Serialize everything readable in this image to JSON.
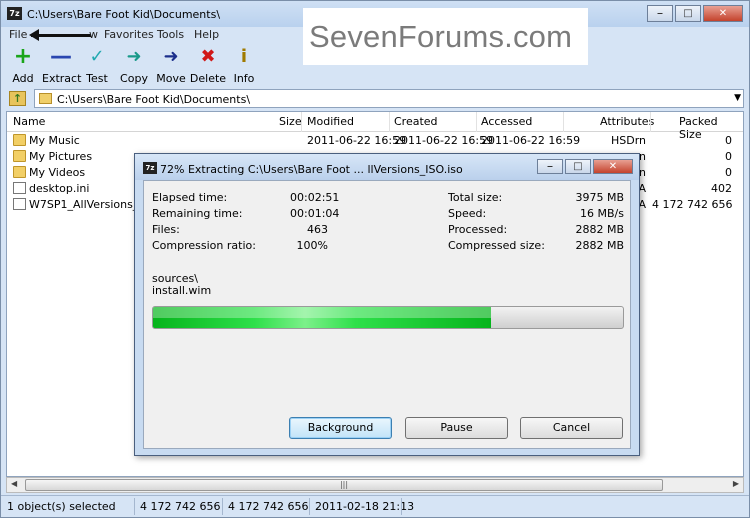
{
  "window": {
    "title": "C:\\Users\\Bare Foot Kid\\Documents\\",
    "icon_text": "7z"
  },
  "menu": {
    "items": [
      "File",
      "Favorites",
      "Tools",
      "Help"
    ],
    "hidden_item_tail": "w"
  },
  "toolbar": {
    "add": "Add",
    "extract": "Extract",
    "test": "Test",
    "copy": "Copy",
    "move": "Move",
    "delete": "Delete",
    "info": "Info"
  },
  "address": {
    "path": "C:\\Users\\Bare Foot Kid\\Documents\\"
  },
  "list": {
    "columns": {
      "name": "Name",
      "size": "Size",
      "modified": "Modified",
      "created": "Created",
      "accessed": "Accessed",
      "attributes": "Attributes",
      "packed_size": "Packed Size"
    },
    "rows": [
      {
        "name": "My Music",
        "modified": "2011-06-22 16:59",
        "created": "2011-06-22 16:59",
        "accessed": "2011-06-22 16:59",
        "attributes": "HSDrn",
        "packed": "0"
      },
      {
        "name": "My Pictures",
        "modified": "",
        "created": "",
        "accessed": "",
        "attributes": "n",
        "packed": "0"
      },
      {
        "name": "My Videos",
        "modified": "",
        "created": "",
        "accessed": "",
        "attributes": "n",
        "packed": "0"
      },
      {
        "name": "desktop.ini",
        "modified": "",
        "created": "",
        "accessed": "",
        "attributes": "A",
        "packed": "402"
      },
      {
        "name": "W7SP1_AllVersions_ISO.",
        "modified": "",
        "created": "",
        "accessed": "",
        "attributes": "A",
        "packed": "4 172 742 656"
      }
    ]
  },
  "scroll": {
    "thumb_grip": "|||"
  },
  "status": {
    "selection": "1 object(s) selected",
    "size": "4 172 742 656",
    "packed": "4 172 742 656",
    "date": "2011-02-18 21:13"
  },
  "watermark": {
    "text": "SevenForums.com"
  },
  "dialog": {
    "title": "72% Extracting C:\\Users\\Bare Foot ... llVersions_ISO.iso",
    "icon_text": "7z",
    "left": [
      {
        "label": "Elapsed time:",
        "value": "00:02:51"
      },
      {
        "label": "Remaining time:",
        "value": "00:01:04"
      },
      {
        "label": "Files:",
        "value": "463"
      },
      {
        "label": "Compression ratio:",
        "value": "100%"
      }
    ],
    "right": [
      {
        "label": "Total size:",
        "value": "3975 MB"
      },
      {
        "label": "Speed:",
        "value": "16 MB/s"
      },
      {
        "label": "Processed:",
        "value": "2882 MB"
      },
      {
        "label": "Compressed size:",
        "value": "2882 MB"
      }
    ],
    "current_folder": "sources\\",
    "current_file": "install.wim",
    "progress_percent": 72,
    "buttons": {
      "background": "Background",
      "pause": "Pause",
      "cancel": "Cancel"
    }
  },
  "colors": {
    "progress_green": "#06b41c",
    "window_frame": "#d6e4f5",
    "close_red": "#c4422c"
  },
  "icons": [
    "add-icon",
    "extract-icon",
    "test-icon",
    "copy-icon",
    "move-icon",
    "delete-icon",
    "info-icon",
    "folder-icon",
    "file-icon",
    "up-folder-icon"
  ]
}
